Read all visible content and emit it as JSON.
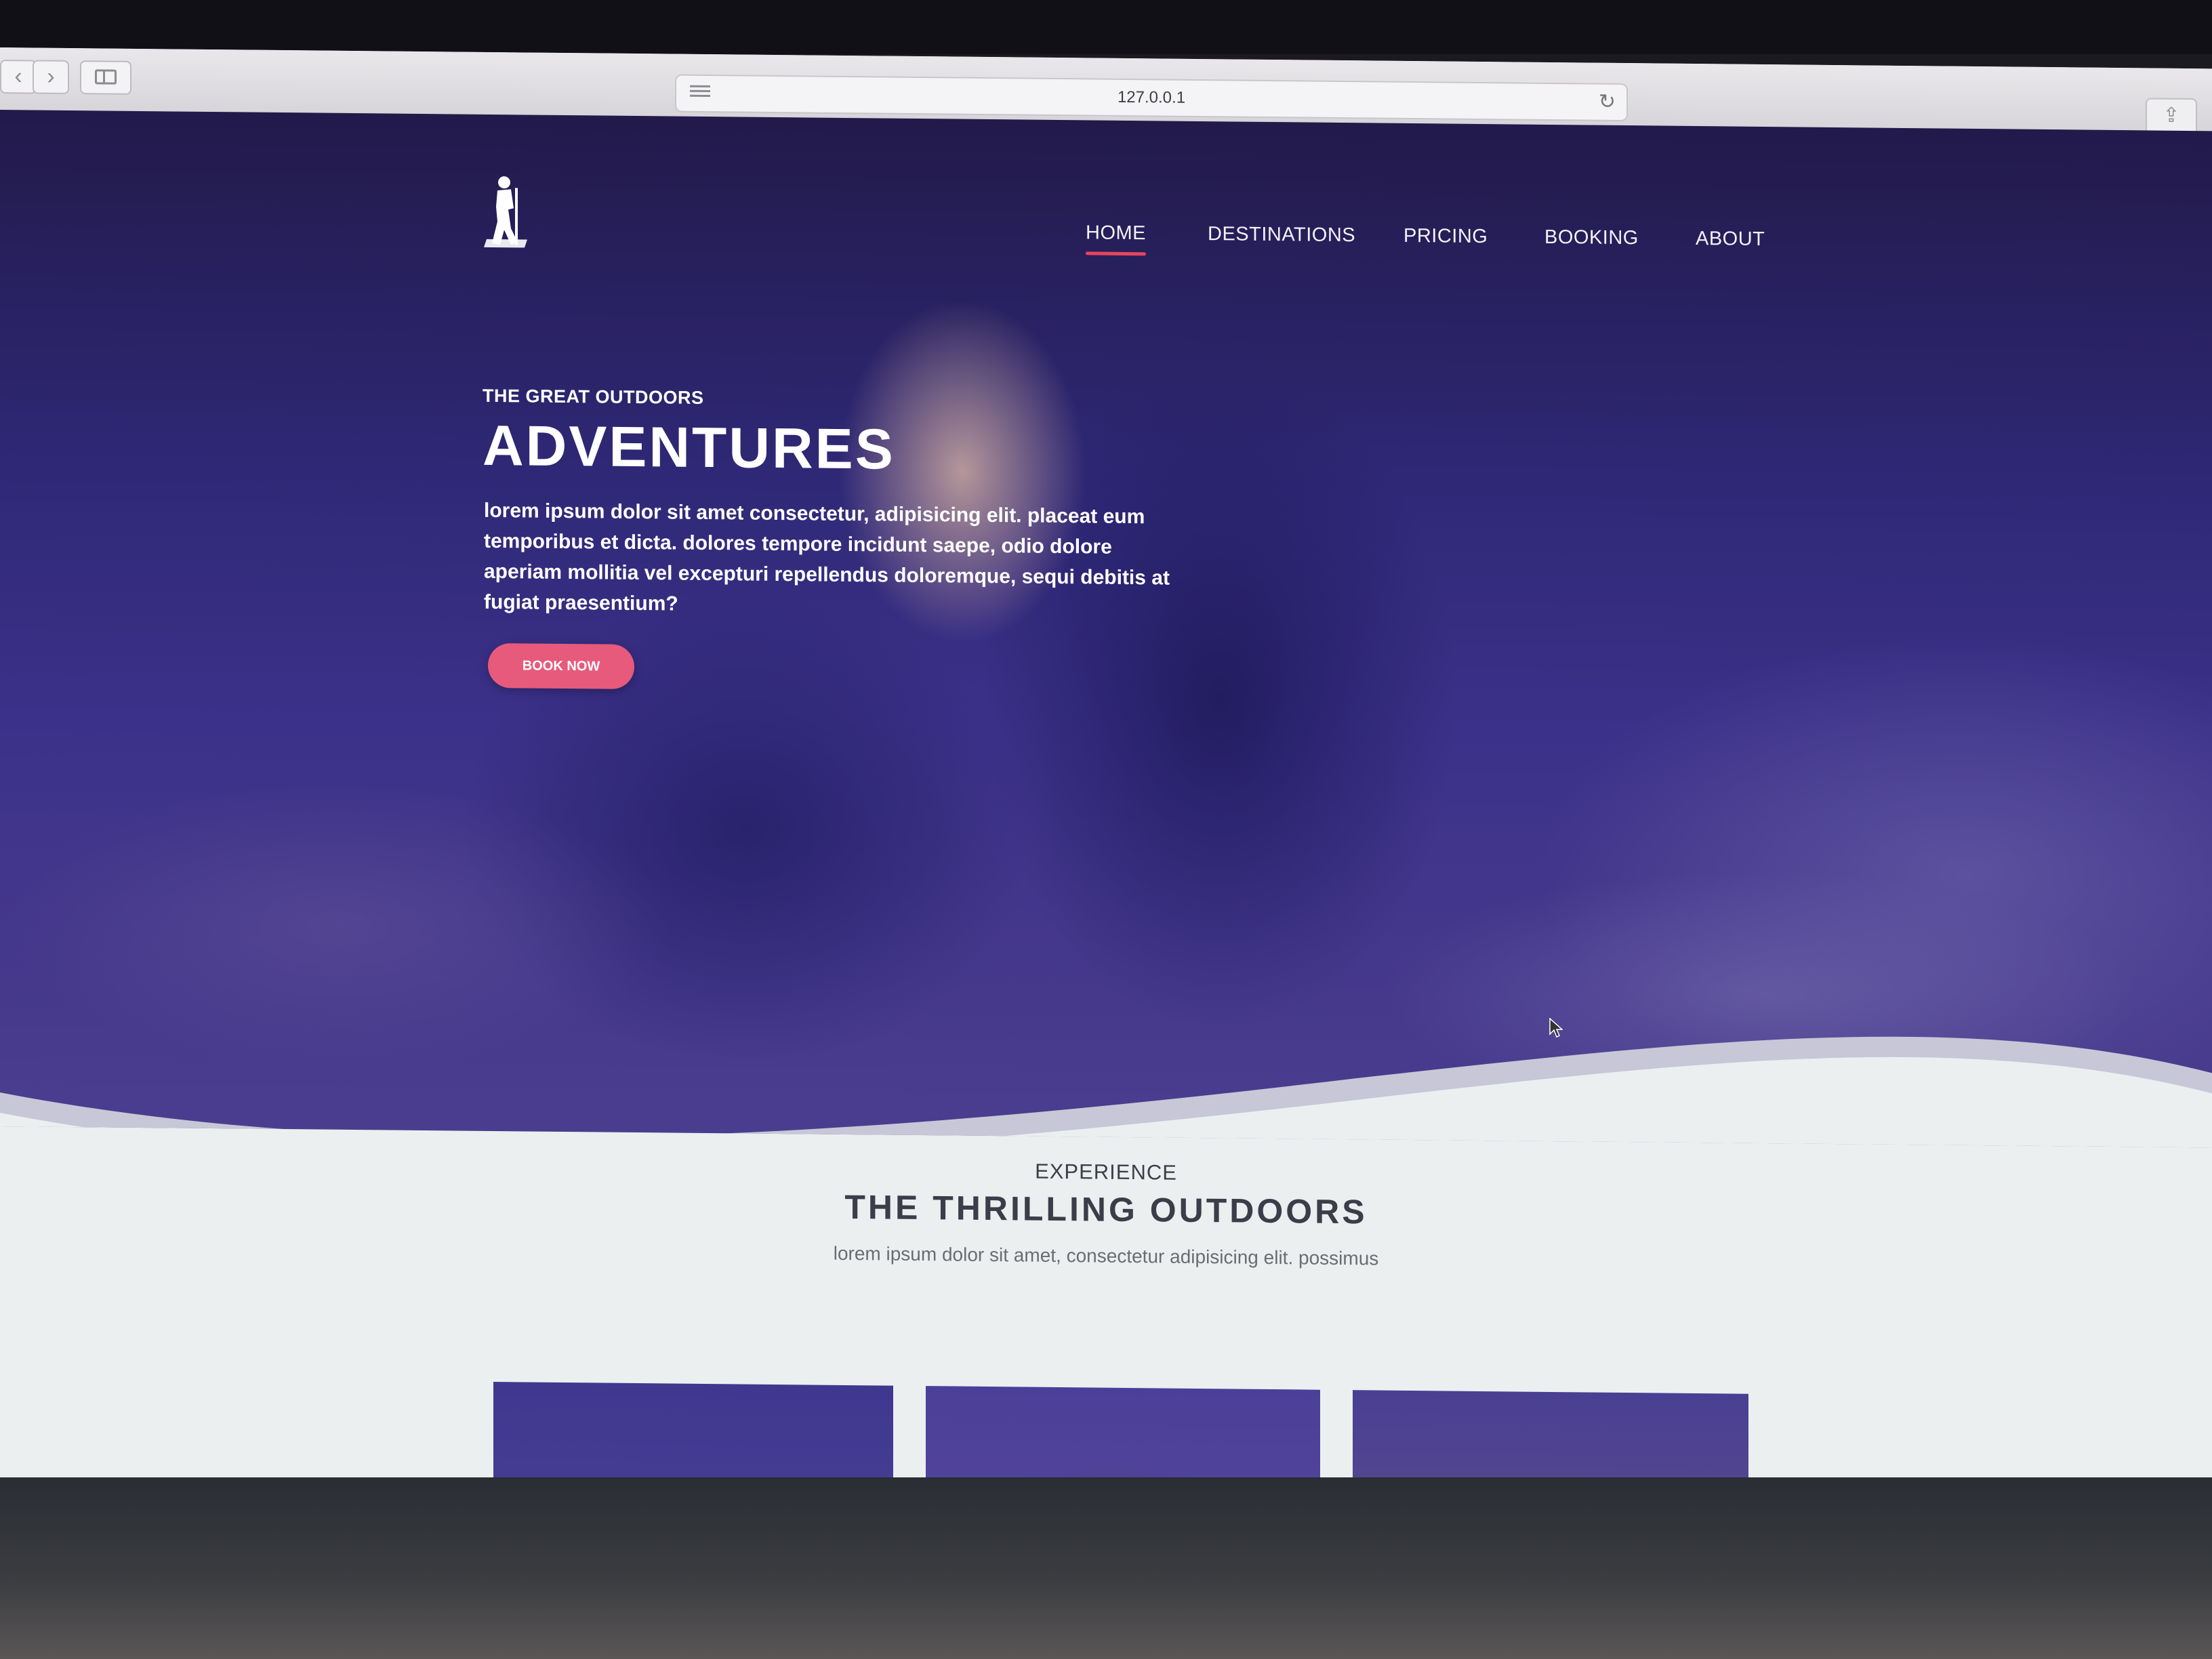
{
  "browser": {
    "back_icon": "chevron-left-icon",
    "forward_icon": "chevron-right-icon",
    "sidebar_icon": "sidebar-icon",
    "reader_icon": "reader-lines-icon",
    "url": "127.0.0.1",
    "reload_icon": "reload-icon",
    "share_icon": "share-icon"
  },
  "site": {
    "logo_icon": "hiker-icon",
    "nav": [
      {
        "label": "HOME",
        "active": true
      },
      {
        "label": "DESTINATIONS",
        "active": false
      },
      {
        "label": "PRICING",
        "active": false
      },
      {
        "label": "BOOKING",
        "active": false
      },
      {
        "label": "ABOUT",
        "active": false
      }
    ]
  },
  "hero": {
    "eyebrow": "THE GREAT OUTDOORS",
    "title": "ADVENTURES",
    "text": "lorem ipsum dolor sit amet consectetur, adipisicing elit. placeat eum temporibus et dicta. dolores tempore incidunt saepe, odio dolore aperiam mollitia vel excepturi repellendus doloremque, sequi debitis at fugiat praesentium?",
    "button_label": "BOOK NOW"
  },
  "experience": {
    "eyebrow": "EXPERIENCE",
    "title": "THE THRILLING OUTDOORS",
    "subtitle": "lorem ipsum dolor sit amet, consectetur adipisicing elit. possimus"
  },
  "colors": {
    "accent": "#e8455f",
    "button": "#e75a7c",
    "hero": "#2f2876"
  }
}
